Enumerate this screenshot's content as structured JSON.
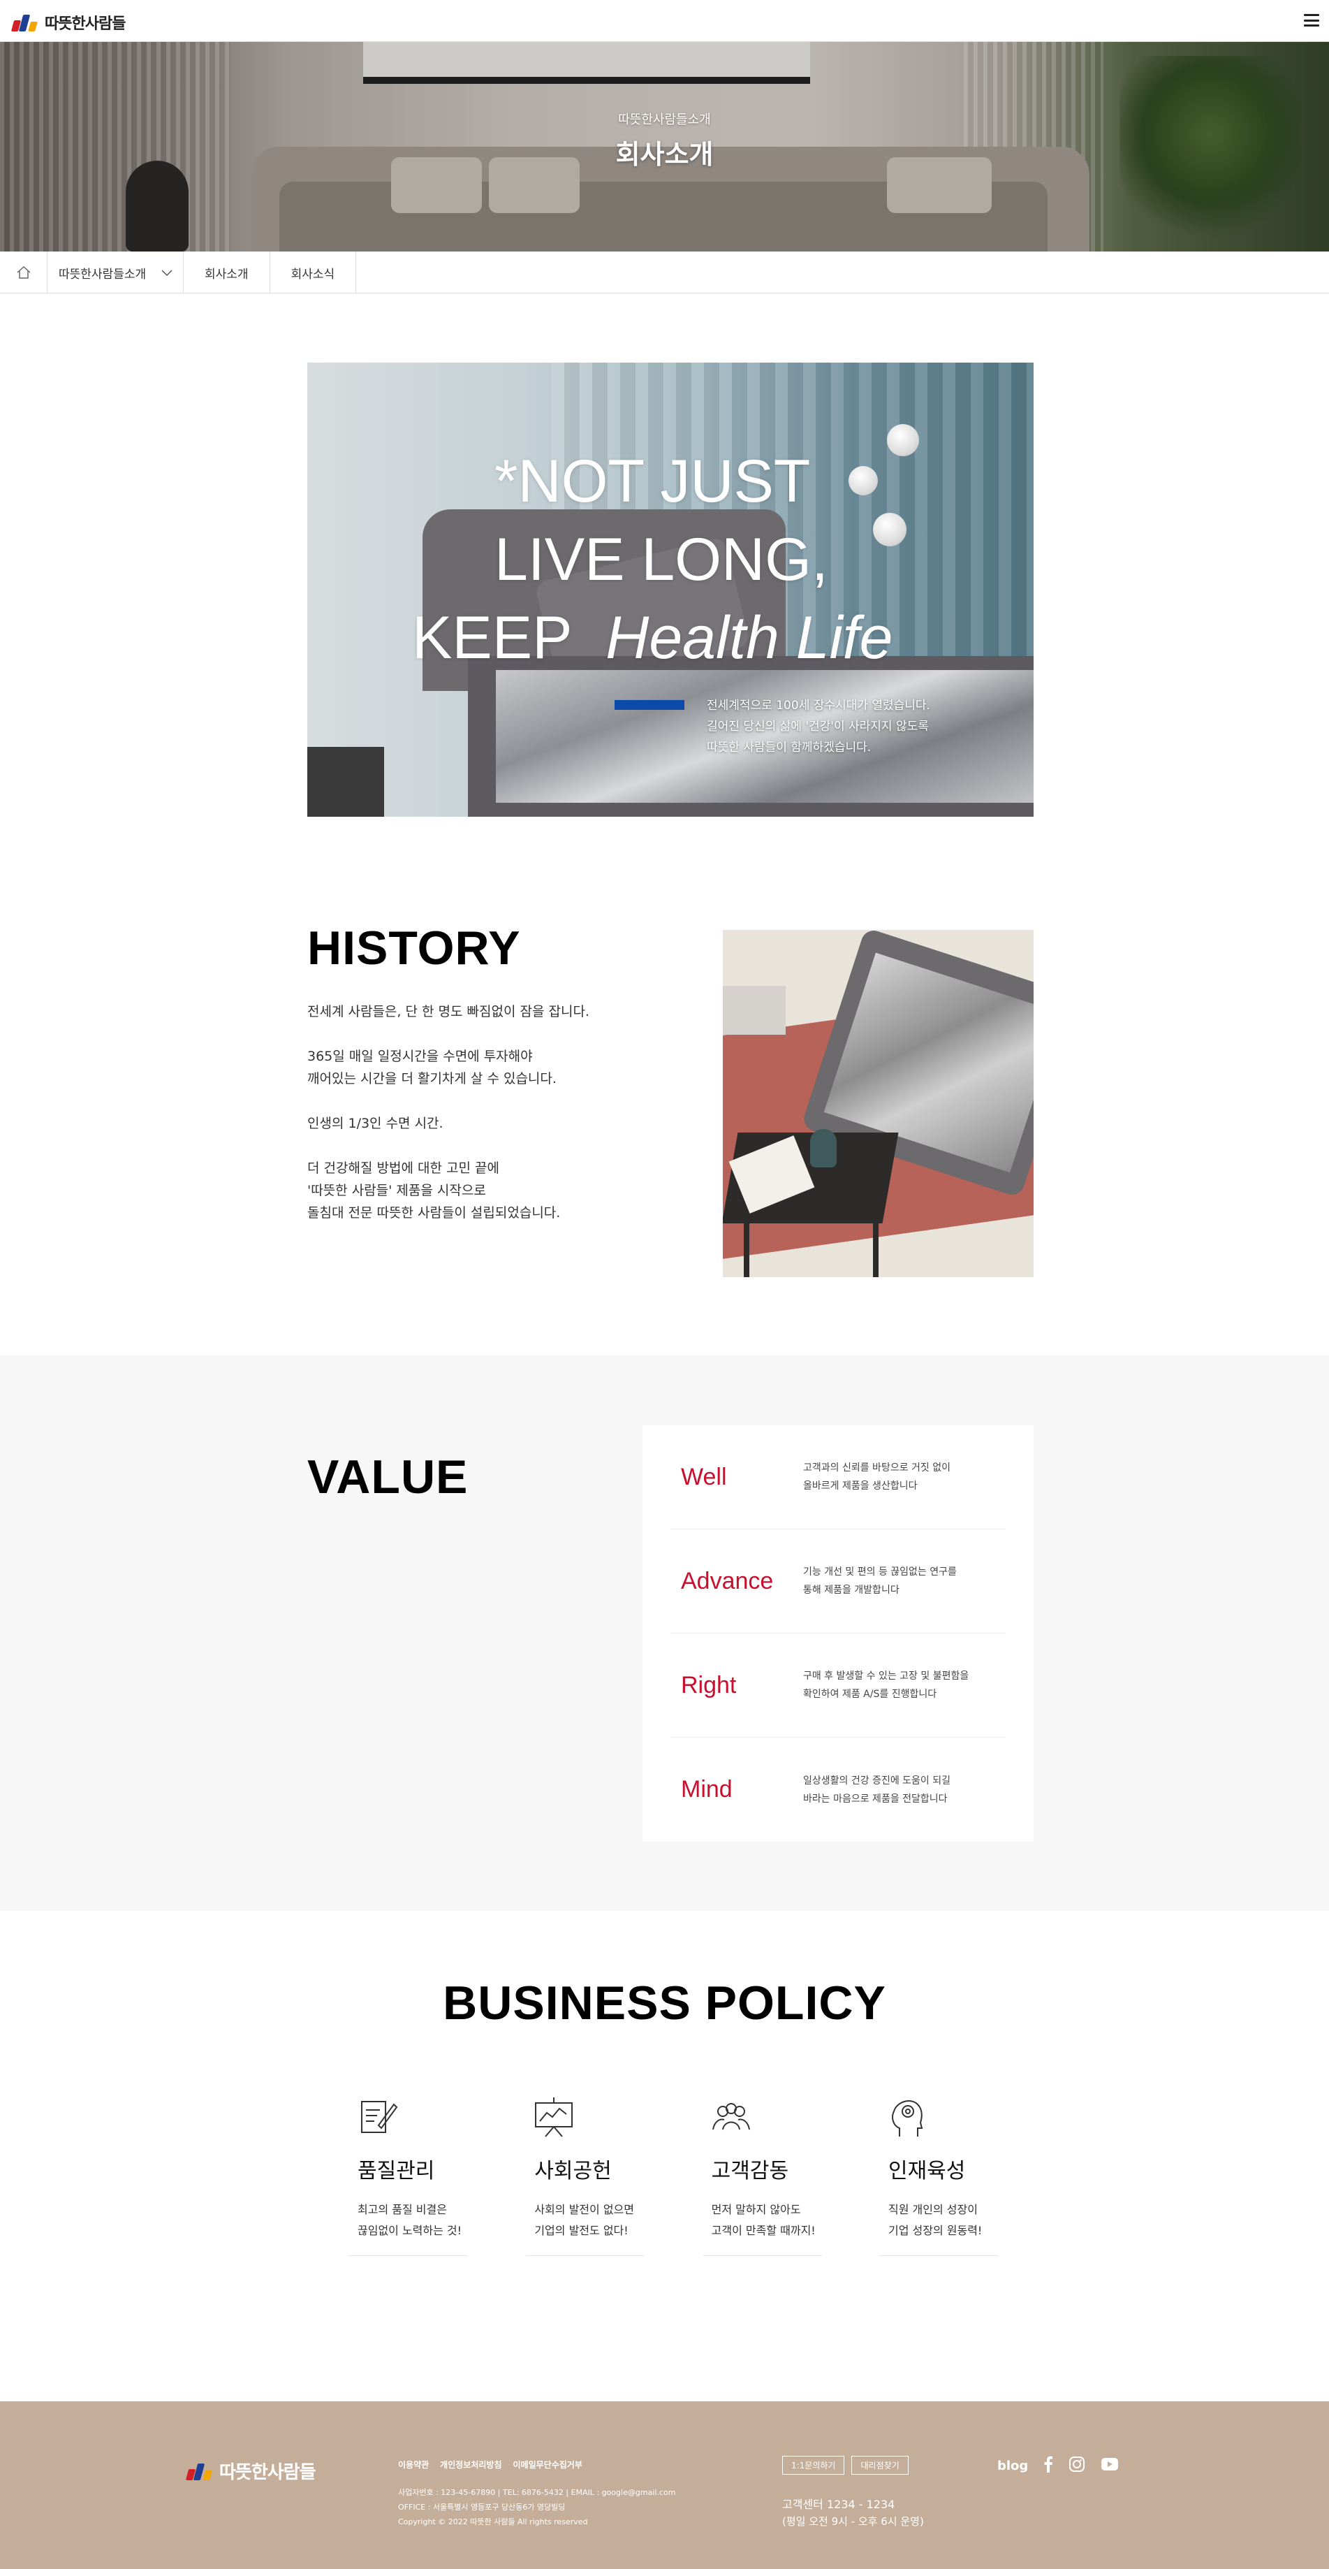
{
  "header": {
    "logo_text": "따뜻한사람들",
    "menu_icon": "hamburger-icon"
  },
  "hero": {
    "subtitle": "따뜻한사람들소개",
    "title": "회사소개"
  },
  "breadcrumb": {
    "home_icon": "home-icon",
    "current": "따뜻한사람들소개",
    "dropdown_icon": "chevron-down-icon",
    "items": [
      "회사소개",
      "회사소식"
    ]
  },
  "intro": {
    "line1": "*NOT JUST",
    "line2": "LIVE LONG,",
    "line3_plain": "KEEP",
    "line3_italic": "Health Life",
    "text": [
      "전세계적으로 100세 장수시대가 열렸습니다.",
      "길어진 당신의 삶에 '건강'이 사라지지 않도록",
      "따뜻한 사람들이 함께하겠습니다."
    ]
  },
  "history": {
    "title": "HISTORY",
    "paragraphs": [
      [
        "전세계 사람들은, 단 한 명도 빠짐없이 잠을 잡니다."
      ],
      [
        "365일 매일 일정시간을 수면에 투자해야",
        "깨어있는 시간을 더 활기차게 살 수 있습니다."
      ],
      [
        "인생의 1/3인 수면 시간."
      ],
      [
        "더 건강해질 방법에 대한 고민 끝에",
        "'따뜻한 사람들' 제품을 시작으로",
        "돌침대 전문 따뜻한 사람들이 설립되었습니다."
      ]
    ]
  },
  "value": {
    "title": "VALUE",
    "items": [
      {
        "name": "Well",
        "desc": [
          "고객과의 신뢰를 바탕으로 거짓 없이",
          "올바르게 제품을 생산합니다"
        ]
      },
      {
        "name": "Advance",
        "desc": [
          "기능 개선 및 편의 등 끊임없는 연구를",
          "통해 제품을 개발합니다"
        ]
      },
      {
        "name": "Right",
        "desc": [
          "구매 후 발생할 수 있는 고장 및 불편함을",
          "확인하여 제품 A/S를 진행합니다"
        ]
      },
      {
        "name": "Mind",
        "desc": [
          "일상생활의 건강 증진에 도움이 되길",
          "바라는 마음으로 제품을 전달합니다"
        ]
      }
    ],
    "accent_color": "#c8102e"
  },
  "business_policy": {
    "title": "BUSINESS POLICY",
    "items": [
      {
        "icon": "document-pen-icon",
        "name": "품질관리",
        "desc": [
          "최고의 품질 비결은",
          "끊임없이 노력하는 것!"
        ]
      },
      {
        "icon": "presentation-chart-icon",
        "name": "사회공헌",
        "desc": [
          "사회의 발전이 없으면",
          "기업의 발전도 없다!"
        ]
      },
      {
        "icon": "people-group-icon",
        "name": "고객감동",
        "desc": [
          "먼저 말하지 않아도",
          "고객이 만족할 때까지!"
        ]
      },
      {
        "icon": "head-gear-icon",
        "name": "인재육성",
        "desc": [
          "직원 개인의 성장이",
          "기업 성장의 원동력!"
        ]
      }
    ]
  },
  "footer": {
    "logo_text": "따뜻한사람들",
    "links": [
      "이용약관",
      "개인정보처리방침",
      "이메일무단수집거부"
    ],
    "info": [
      "사업자번호 : 123-45-67890  |  TEL: 6876-5432  |  EMAIL : google@gmail.com",
      "OFFICE : 서울특별시 영등포구 당산동6가 영당빌딩",
      "Copyright © 2022 따뜻한 사람들 All rights reserved"
    ],
    "buttons": [
      "1:1문의하기",
      "대리점찾기"
    ],
    "cs_title": "고객센터 1234 - 1234",
    "cs_hours": "(평일 오전 9시 - 오후 6시 운영)",
    "social": {
      "blog": "blog",
      "icons": [
        "facebook-icon",
        "instagram-icon",
        "youtube-icon"
      ]
    },
    "bg_color": "#c4ae99"
  }
}
